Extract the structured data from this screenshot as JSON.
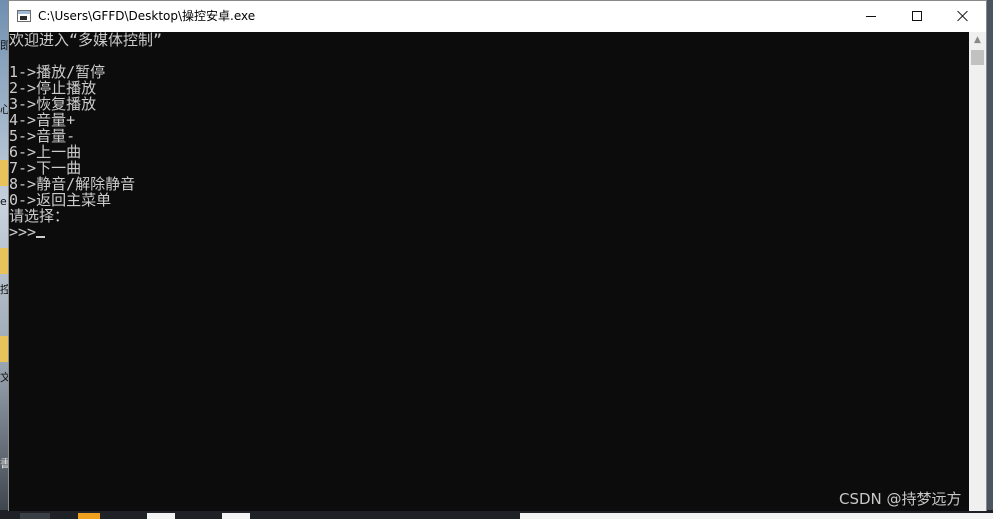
{
  "window": {
    "title": "C:\\Users\\GFFD\\Desktop\\操控安卓.exe",
    "app_icon": "console-app-icon",
    "controls": {
      "minimize_icon": "minimize-icon",
      "maximize_icon": "maximize-icon",
      "close_icon": "close-icon"
    }
  },
  "console": {
    "background": "#0c0c0c",
    "foreground": "#cccccc",
    "lines": [
      "欢迎进入“多媒体控制”",
      "",
      "1->播放/暂停",
      "2->停止播放",
      "3->恢复播放",
      "4->音量+",
      "5->音量-",
      "6->上一曲",
      "7->下一曲",
      "8->静音/解除静音",
      "0->返回主菜单",
      "请选择：",
      ">>>"
    ]
  },
  "scrollbar": {
    "up_arrow_icon": "scroll-up-arrow-icon"
  },
  "watermark": "CSDN @持梦远方"
}
